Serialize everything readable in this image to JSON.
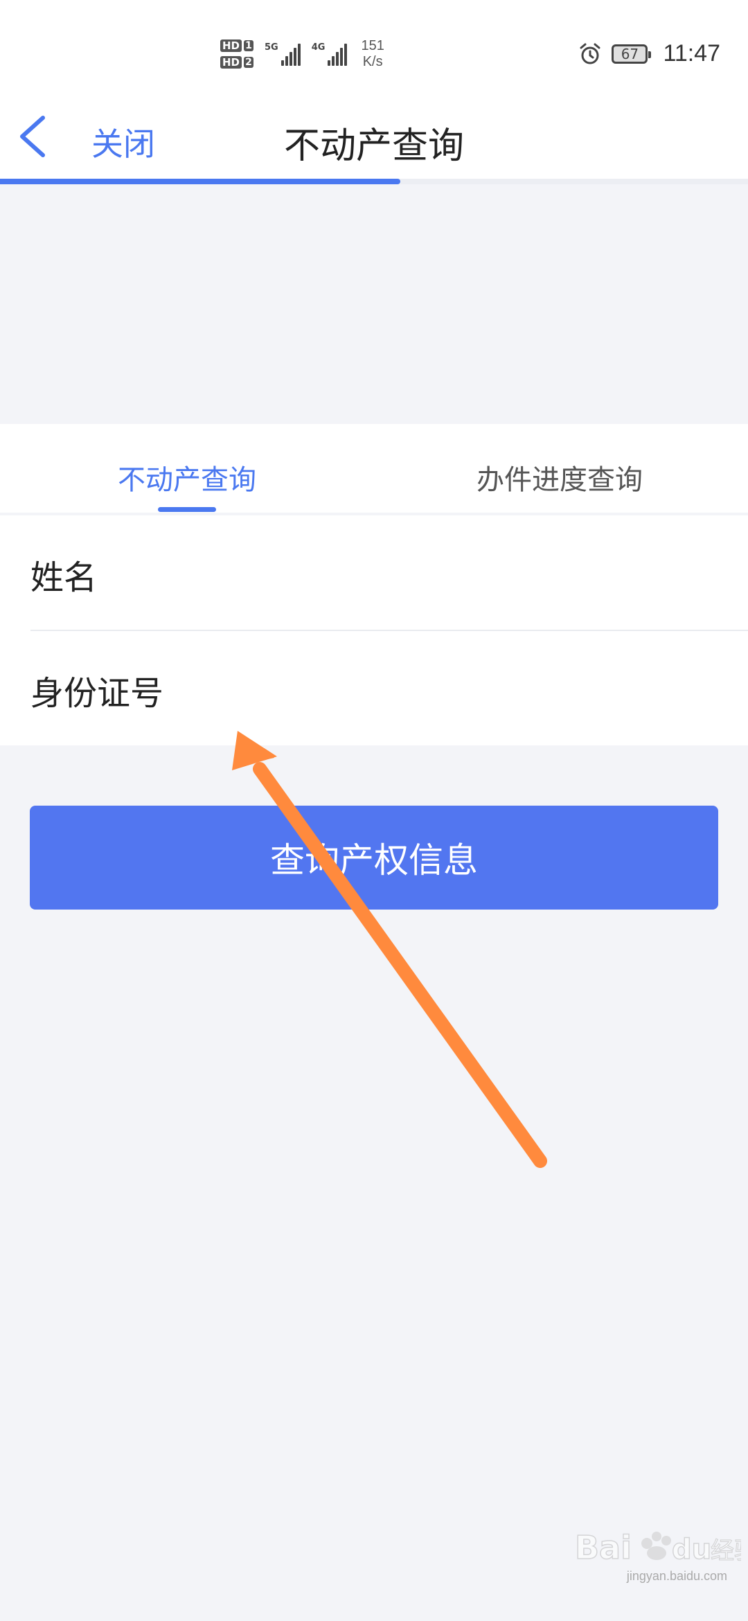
{
  "status_bar": {
    "sim1_label": "HD",
    "sim1_slot": "1",
    "sim2_label": "HD",
    "sim2_slot": "2",
    "sig1_type": "5G",
    "sig2_type": "4G",
    "speed_value": "151",
    "speed_unit": "K/s",
    "battery": "67",
    "time": "11:47"
  },
  "navbar": {
    "back_icon": "chevron-left-icon",
    "close_label": "关闭",
    "title": "不动产查询",
    "progress": 0.535
  },
  "tabs": [
    {
      "label": "不动产查询",
      "active": true
    },
    {
      "label": "办件进度查询",
      "active": false
    }
  ],
  "form": {
    "name_label": "姓名",
    "name_value": "",
    "id_label": "身份证号",
    "id_value": ""
  },
  "submit_label": "查询产权信息",
  "watermark": {
    "brand": "Baidu 经验",
    "url": "jingyan.baidu.com"
  },
  "colors": {
    "accent": "#4a78f0",
    "button": "#5276f0",
    "arrow": "#ff8a3d",
    "background": "#f3f4f8"
  }
}
